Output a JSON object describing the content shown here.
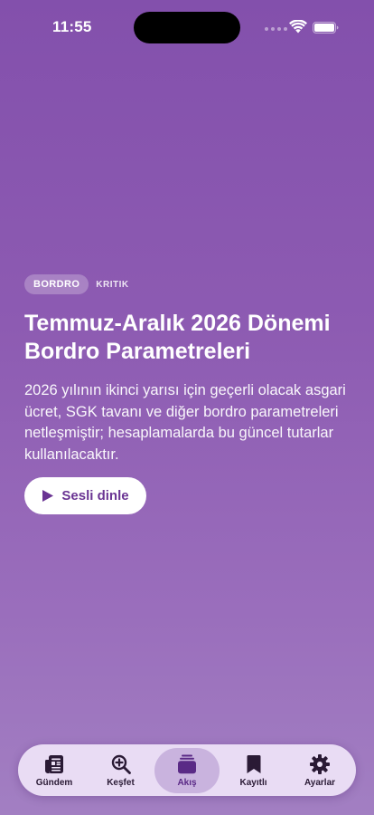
{
  "status_bar": {
    "time": "11:55",
    "icons": [
      "signal-dots",
      "wifi-icon",
      "battery-icon"
    ]
  },
  "article": {
    "category": "BORDRO",
    "priority": "KRITIK",
    "title": "Temmuz-Aralık 2026 Dönemi Bordro Parametreleri",
    "summary": "2026 yılının ikinci yarısı için geçerli olacak asgari ücret, SGK tavanı ve diğer bordro parametreleri netleşmiştir; hesaplamalarda bu güncel tutarlar kullanılacaktır.",
    "listen_label": "Sesli dinle",
    "listen_icon": "play-icon"
  },
  "tab_bar": {
    "items": [
      {
        "label": "Gündem",
        "icon": "newspaper-icon",
        "active": false
      },
      {
        "label": "Keşfet",
        "icon": "magnify-plus-icon",
        "active": false
      },
      {
        "label": "Akış",
        "icon": "stack-icon",
        "active": true
      },
      {
        "label": "Kayıtlı",
        "icon": "bookmark-icon",
        "active": false
      },
      {
        "label": "Ayarlar",
        "icon": "gear-icon",
        "active": false
      }
    ]
  },
  "colors": {
    "background_top": "#8350ac",
    "background_bottom": "#a27fc2",
    "accent": "#6a3493",
    "tab_active": "#5a2a86"
  }
}
